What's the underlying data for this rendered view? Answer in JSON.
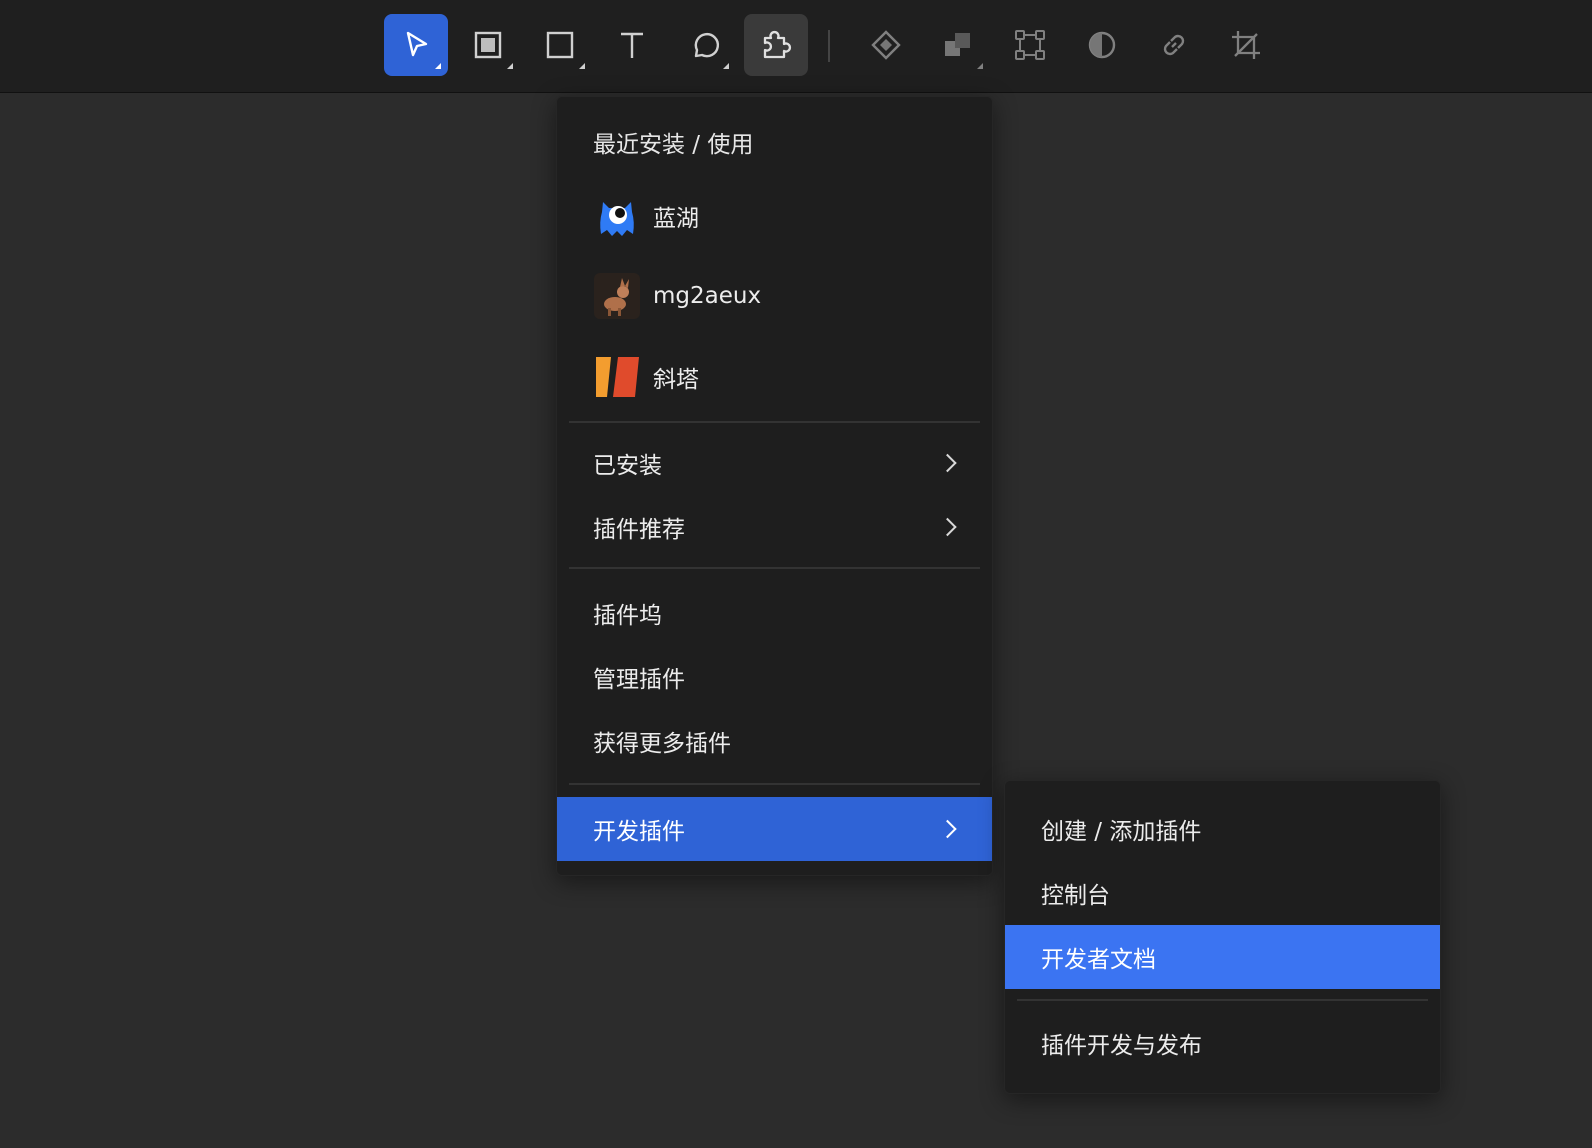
{
  "main_menu": {
    "header": "最近安装 / 使用",
    "recent": [
      {
        "label": "蓝湖",
        "icon": "lanhu-monster-icon"
      },
      {
        "label": "mg2aeux",
        "icon": "mg2aeux-dog-icon"
      },
      {
        "label": "斜塔",
        "icon": "xieta-bars-icon"
      }
    ],
    "installed": "已安装",
    "recommended": "插件推荐",
    "dock": "插件坞",
    "manage": "管理插件",
    "get_more": "获得更多插件",
    "develop": "开发插件"
  },
  "sub_menu": {
    "create": "创建 / 添加插件",
    "console": "控制台",
    "docs": "开发者文档",
    "publish": "插件开发与发布"
  },
  "colors": {
    "accent": "#2f63d6",
    "accent_bright": "#3b74f2",
    "canvas": "#2c2c2c",
    "toolbar": "#1f1f1f",
    "menu_bg": "#1e1e1e"
  }
}
